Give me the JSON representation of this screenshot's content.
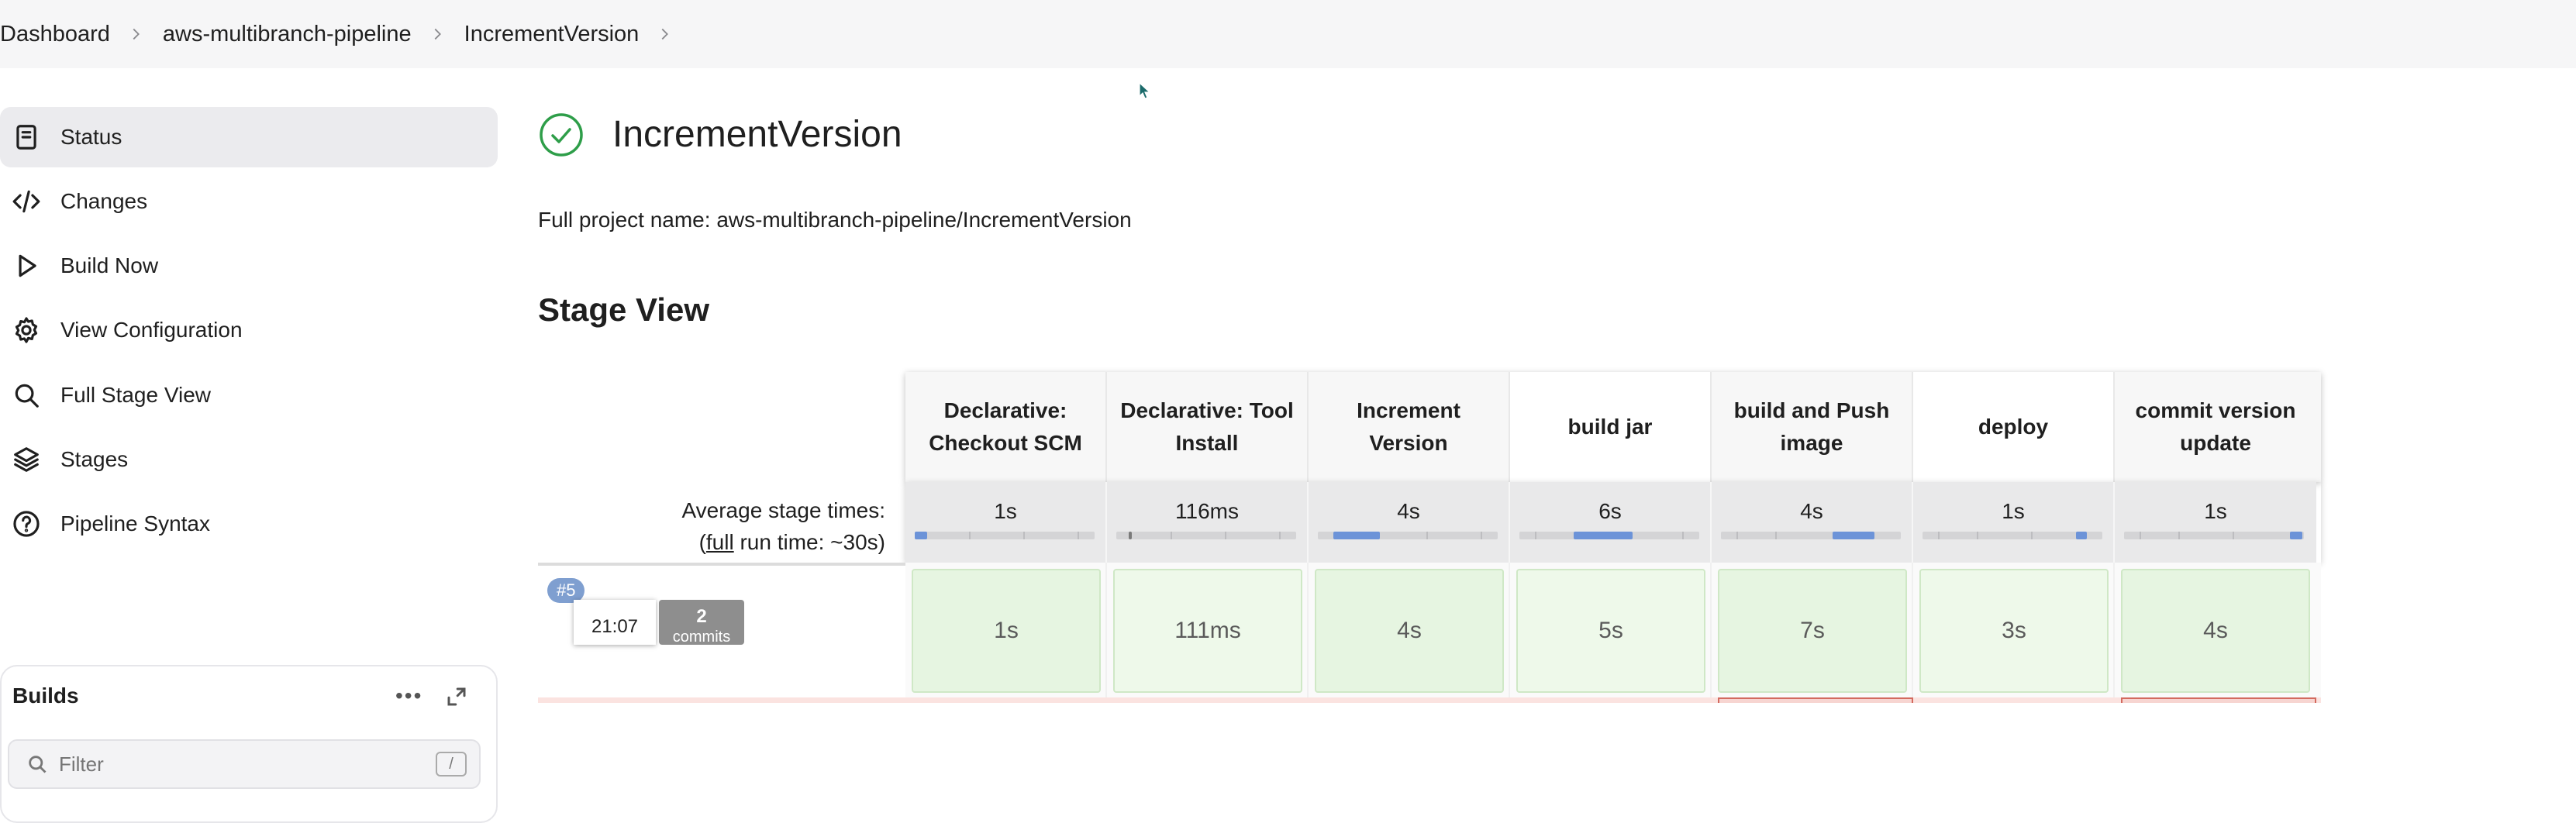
{
  "breadcrumb": [
    "Dashboard",
    "aws-multibranch-pipeline",
    "IncrementVersion"
  ],
  "sidebar": {
    "items": [
      {
        "label": "Status",
        "icon": "document-icon",
        "active": true
      },
      {
        "label": "Changes",
        "icon": "code-icon",
        "active": false
      },
      {
        "label": "Build Now",
        "icon": "play-icon",
        "active": false
      },
      {
        "label": "View Configuration",
        "icon": "gear-icon",
        "active": false
      },
      {
        "label": "Full Stage View",
        "icon": "search-icon",
        "active": false
      },
      {
        "label": "Stages",
        "icon": "layers-icon",
        "active": false
      },
      {
        "label": "Pipeline Syntax",
        "icon": "help-icon",
        "active": false
      }
    ],
    "builds": {
      "title": "Builds",
      "more": "•••",
      "filter_placeholder": "Filter",
      "filter_shortcut": "/"
    }
  },
  "main": {
    "title": "IncrementVersion",
    "status_color": "#2e9e49",
    "full_project_name": "Full project name: aws-multibranch-pipeline/IncrementVersion",
    "section_title": "Stage View",
    "stage_view": {
      "avg_label_line1": "Average stage times:",
      "avg_label_prefix": "(",
      "avg_label_link": "full",
      "avg_label_suffix": " run time: ~30s)",
      "stages": [
        {
          "name": "Declarative: Checkout SCM",
          "avg": "1s"
        },
        {
          "name": "Declarative: Tool Install",
          "avg": "116ms"
        },
        {
          "name": "Increment Version",
          "avg": "4s"
        },
        {
          "name": "build jar",
          "avg": "6s"
        },
        {
          "name": "build and Push image",
          "avg": "4s"
        },
        {
          "name": "deploy",
          "avg": "1s"
        },
        {
          "name": "commit version update",
          "avg": "1s"
        }
      ],
      "run": {
        "badge": "#5",
        "time": "21:07",
        "commits_count": "2",
        "commits_label": "commits",
        "durations": [
          "1s",
          "111ms",
          "4s",
          "5s",
          "7s",
          "3s",
          "4s"
        ]
      }
    }
  },
  "colors": {
    "accent_blue": "#6c93d8",
    "success_green_bg": "#e6f5e1",
    "failed_red": "#d36a5f"
  }
}
